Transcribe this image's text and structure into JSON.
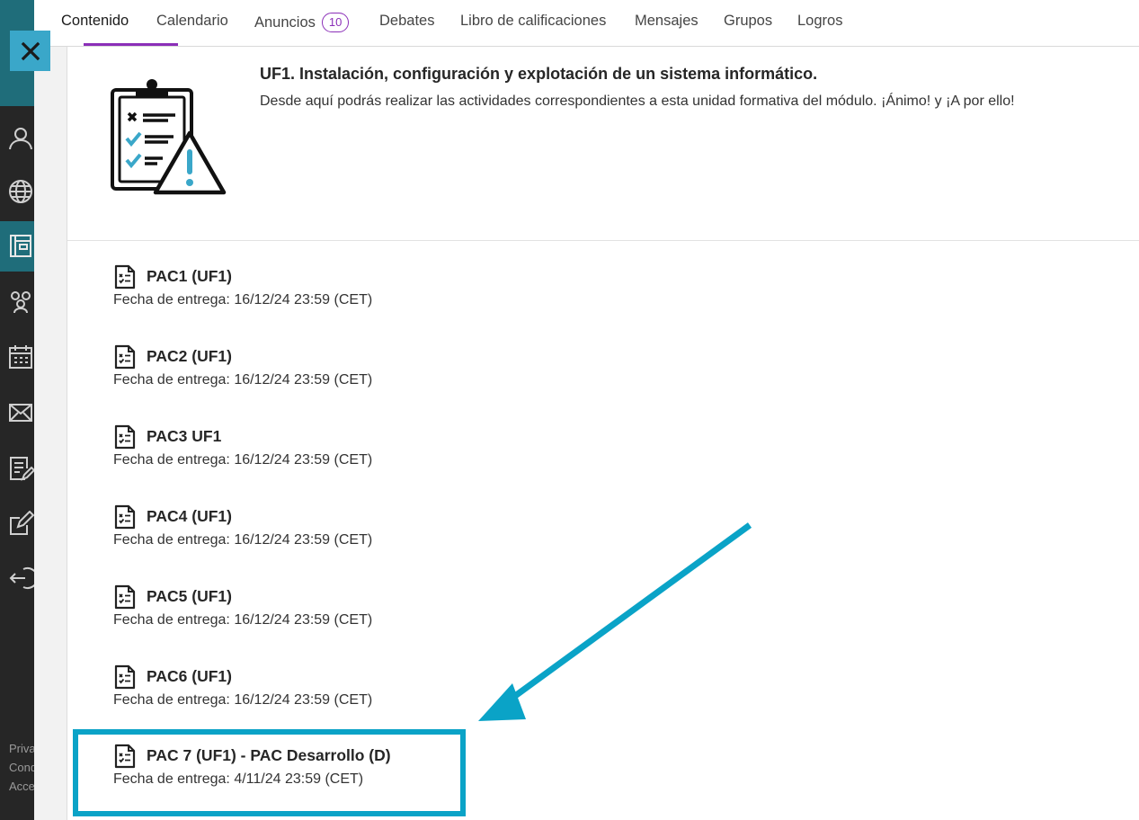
{
  "tabs": [
    {
      "label": "Contenido",
      "active": true
    },
    {
      "label": "Calendario"
    },
    {
      "label": "Anuncios",
      "badge": "10"
    },
    {
      "label": "Debates"
    },
    {
      "label": "Libro de calificaciones"
    },
    {
      "label": "Mensajes"
    },
    {
      "label": "Grupos"
    },
    {
      "label": "Logros"
    }
  ],
  "sidebar": {
    "icons": [
      "user-icon",
      "globe-icon",
      "courses-icon",
      "groups-icon",
      "calendar-icon",
      "mail-icon",
      "grades-icon",
      "edit-icon",
      "logout-icon"
    ],
    "footer_lines": [
      "Priva",
      "Cond",
      "Acce"
    ]
  },
  "unit": {
    "title": "UF1. Instalación, configuración y explotación de un sistema informático.",
    "description": "Desde aquí podrás realizar las actividades correspondientes a esta unidad formativa del módulo. ¡Ánimo! y ¡A por ello!"
  },
  "items": [
    {
      "title": "PAC1 (UF1)",
      "due": "Fecha de entrega: 16/12/24 23:59 (CET)"
    },
    {
      "title": "PAC2 (UF1)",
      "due": "Fecha de entrega: 16/12/24 23:59 (CET)"
    },
    {
      "title": "PAC3 UF1",
      "due": "Fecha de entrega: 16/12/24 23:59 (CET)"
    },
    {
      "title": "PAC4 (UF1)",
      "due": "Fecha de entrega: 16/12/24 23:59 (CET)"
    },
    {
      "title": "PAC5 (UF1)",
      "due": "Fecha de entrega: 16/12/24 23:59 (CET)"
    },
    {
      "title": "PAC6 (UF1)",
      "due": "Fecha de entrega: 16/12/24 23:59 (CET)"
    },
    {
      "title": "PAC 7 (UF1) - PAC Desarrollo (D)",
      "due": "Fecha de entrega: 4/11/24 23:59 (CET)"
    }
  ],
  "colors": {
    "accent_purple": "#8b2fb8",
    "highlight_teal": "#0aa3c7",
    "nav_dark": "#262626",
    "nav_teal": "#1f6d7a"
  }
}
